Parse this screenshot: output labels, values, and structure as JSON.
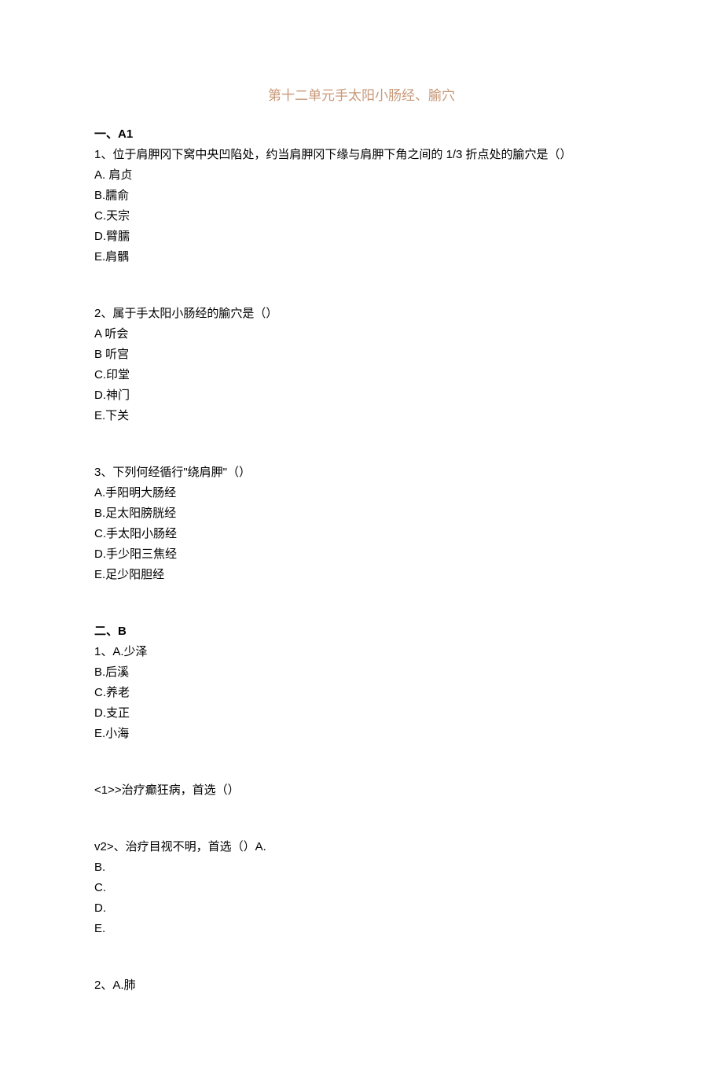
{
  "title": "第十二单元手太阳小肠经、腧穴",
  "section_a": {
    "header": "一、A1",
    "questions": [
      {
        "text": "1、位于肩胛冈下窝中央凹陷处，约当肩胛冈下缘与肩胛下角之间的 1/3 折点处的腧穴是（）",
        "options": {
          "a": "A. 肩贞",
          "b": "B.臑俞",
          "c": "C.天宗",
          "d": "D.臂臑",
          "e": "E.肩髃"
        }
      },
      {
        "text": "2、属于手太阳小肠经的腧穴是（）",
        "options": {
          "a": "A 听会",
          "b": "B 听宫",
          "c": "C.印堂",
          "d": "D.神门",
          "e": "E.下关"
        }
      },
      {
        "text": "3、下列何经循行\"绕肩胛\"（）",
        "options": {
          "a": "A.手阳明大肠经",
          "b": "B.足太阳膀胱经",
          "c": "C.手太阳小肠经",
          "d": "D.手少阳三焦经",
          "e": "E.足少阳胆经"
        }
      }
    ]
  },
  "section_b": {
    "header": "二、B",
    "questions": [
      {
        "text": "1、A.少泽",
        "options": {
          "b": "B.后溪",
          "c": "C.养老",
          "d": "D.支正",
          "e": "E.小海"
        },
        "sub_questions": [
          {
            "text": "<1>>治疗癫狂病，首选（）"
          },
          {
            "text": "v2>、治疗目视不明，首选（）A.",
            "options": {
              "b": "B.",
              "c": "C.",
              "d": "D.",
              "e": "E."
            }
          }
        ]
      },
      {
        "text": "2、A.肺"
      }
    ]
  }
}
